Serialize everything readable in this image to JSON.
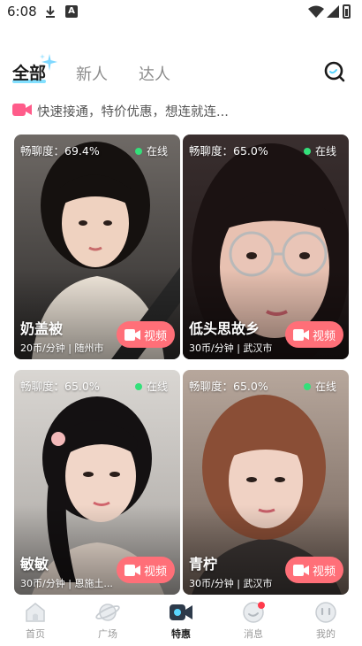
{
  "status_bar": {
    "time": "6:08",
    "a_icon": "A"
  },
  "tabs": [
    {
      "label": "全部",
      "active": true
    },
    {
      "label": "新人",
      "active": false
    },
    {
      "label": "达人",
      "active": false
    }
  ],
  "promo": {
    "text": "快速接通，特价优惠，想连就连..."
  },
  "cards": [
    {
      "rate": "畅聊度：69.4%",
      "online": "在线",
      "name": "奶盖被",
      "meta": "20币/分钟 | 随州市",
      "video": "视频"
    },
    {
      "rate": "畅聊度：65.0%",
      "online": "在线",
      "name": "低头思故乡",
      "meta": "30币/分钟 | 武汉市",
      "video": "视频"
    },
    {
      "rate": "畅聊度：65.0%",
      "online": "在线",
      "name": "敏敏",
      "meta": "30币/分钟 | 恩施土...",
      "video": "视频"
    },
    {
      "rate": "畅聊度：65.0%",
      "online": "在线",
      "name": "青柠",
      "meta": "30币/分钟 | 武汉市",
      "video": "视频"
    }
  ],
  "nav": [
    {
      "label": "首页",
      "icon": "home-icon"
    },
    {
      "label": "广场",
      "icon": "planet-icon"
    },
    {
      "label": "特惠",
      "icon": "video-camera-icon",
      "active": true
    },
    {
      "label": "消息",
      "icon": "message-icon"
    },
    {
      "label": "我的",
      "icon": "profile-icon"
    }
  ],
  "colors": {
    "accent": "#ff6f78",
    "online": "#33e07a",
    "nav_active": "#2d3a4a"
  }
}
